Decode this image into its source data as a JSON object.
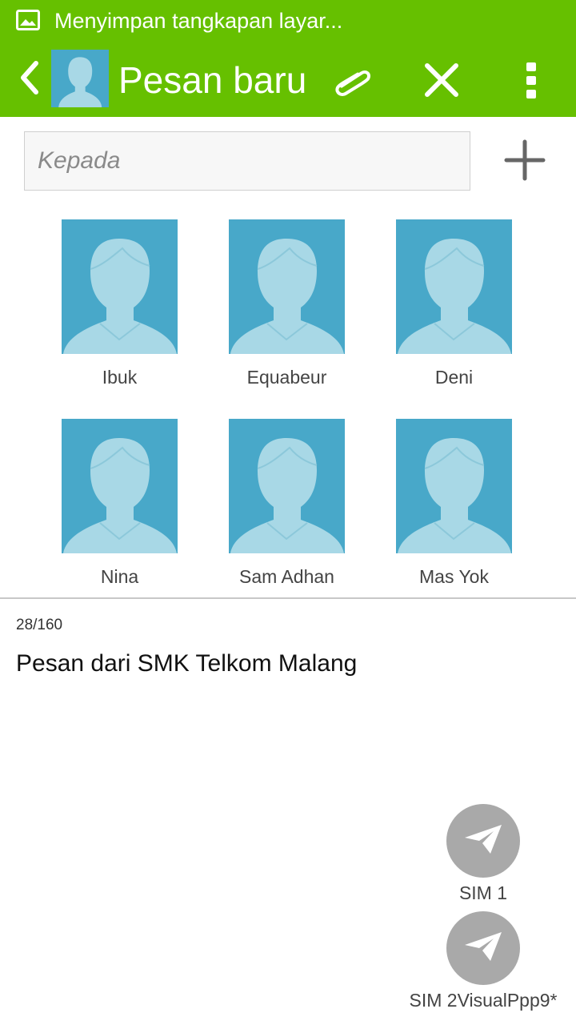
{
  "status_bar": {
    "notification_text": "Menyimpan tangkapan layar...",
    "icon": "image-icon"
  },
  "app_bar": {
    "title": "Pesan baru",
    "back_icon": "back-chevron-icon",
    "attach_icon": "paperclip-icon",
    "close_icon": "close-icon",
    "more_icon": "more-vertical-icon",
    "background": "#66c000"
  },
  "recipient": {
    "placeholder": "Kepada",
    "value": "",
    "add_icon": "plus-icon"
  },
  "contacts": [
    {
      "name": "Ibuk"
    },
    {
      "name": "Equabeur"
    },
    {
      "name": "Deni"
    },
    {
      "name": "Nina"
    },
    {
      "name": "Sam Adhan"
    },
    {
      "name": "Mas Yok"
    }
  ],
  "compose": {
    "char_count": "28/160",
    "message": "Pesan dari SMK Telkom Malang"
  },
  "send": {
    "sim1_label": "SIM 1",
    "sim2_label": "SIM 2VisualPpp9*",
    "icon": "send-icon",
    "button_color": "#a9a9a9"
  },
  "colors": {
    "accent": "#66c000",
    "avatar_bg": "#48a8c9",
    "avatar_fg": "#a8d8e6"
  }
}
